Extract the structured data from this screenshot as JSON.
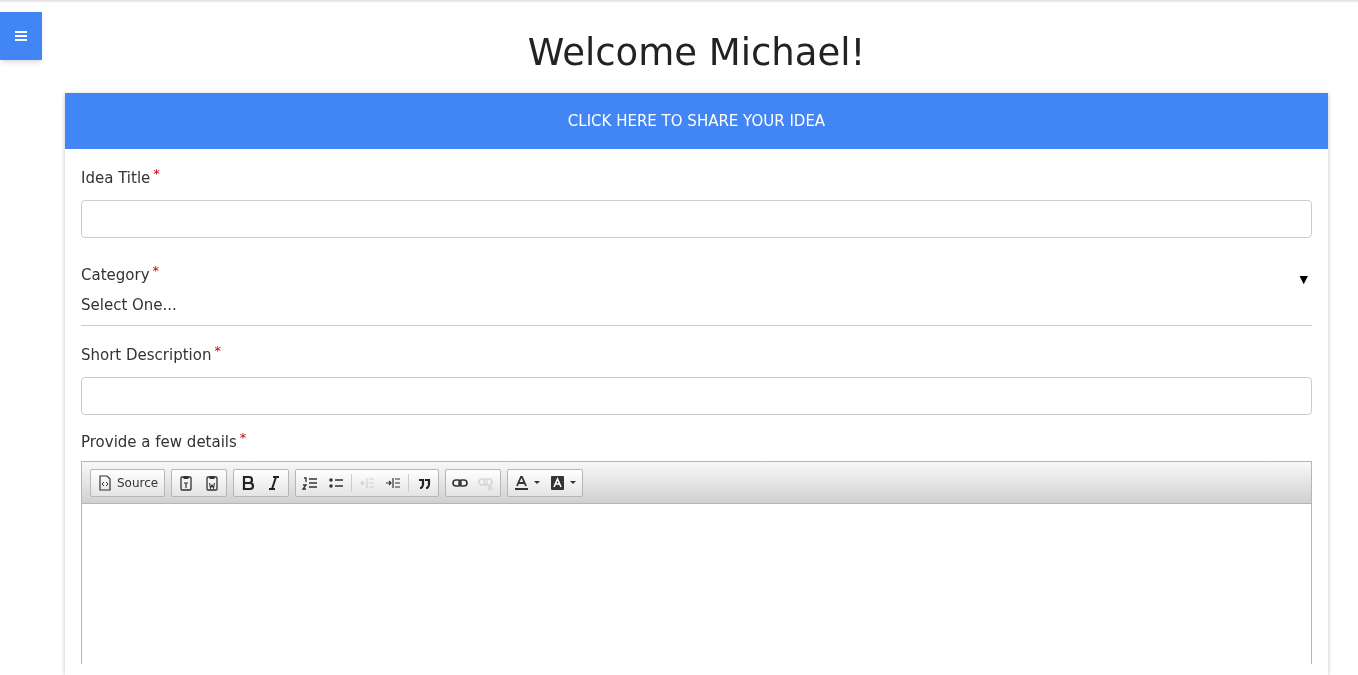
{
  "heading": "Welcome Michael!",
  "banner": {
    "label": "CLICK HERE TO SHARE YOUR IDEA"
  },
  "fields": [
    {
      "kind": "text",
      "label": "Idea Title",
      "required_mark": "*"
    },
    {
      "kind": "select",
      "label": "Category",
      "required_mark": "*",
      "value": "Select One...",
      "arrow": "▼"
    },
    {
      "kind": "text",
      "label": "Short Description",
      "required_mark": "*"
    },
    {
      "kind": "editor",
      "label": "Provide a few details",
      "required_mark": "*"
    }
  ],
  "toolbar": [
    [
      {
        "kind": "source",
        "label": "Source",
        "disabled": false
      }
    ],
    [
      {
        "kind": "paste-text",
        "disabled": false
      },
      {
        "kind": "paste-word",
        "disabled": false
      }
    ],
    [
      {
        "kind": "bold",
        "disabled": false
      },
      {
        "kind": "italic",
        "disabled": false
      }
    ],
    [
      {
        "kind": "numbered-list",
        "disabled": false
      },
      {
        "kind": "bulleted-list",
        "disabled": false
      },
      {
        "kind": "sep"
      },
      {
        "kind": "outdent",
        "disabled": true
      },
      {
        "kind": "indent",
        "disabled": false
      },
      {
        "kind": "sep"
      },
      {
        "kind": "quote",
        "disabled": false
      }
    ],
    [
      {
        "kind": "link",
        "disabled": false
      },
      {
        "kind": "unlink",
        "disabled": true
      }
    ],
    [
      {
        "kind": "text-color",
        "disabled": false
      },
      {
        "kind": "background-color",
        "disabled": false
      }
    ]
  ]
}
